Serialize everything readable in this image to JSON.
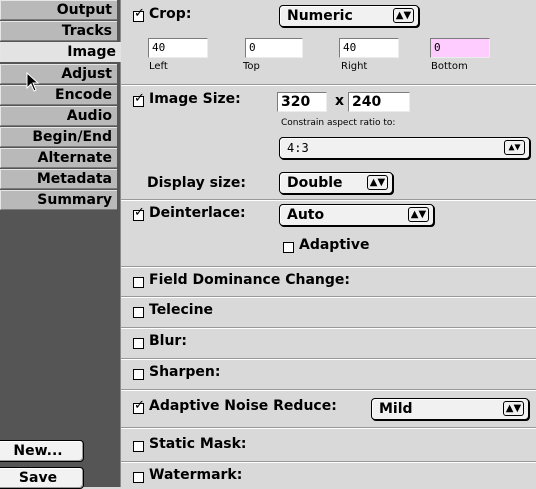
{
  "sidebar": {
    "tabs": [
      {
        "label": "Output"
      },
      {
        "label": "Tracks"
      },
      {
        "label": "Image"
      },
      {
        "label": "Adjust"
      },
      {
        "label": "Encode"
      },
      {
        "label": "Audio"
      },
      {
        "label": "Begin/End"
      },
      {
        "label": "Alternate"
      },
      {
        "label": "Metadata"
      },
      {
        "label": "Summary"
      }
    ],
    "active_tab": "Image",
    "buttons": {
      "new_label": "New...",
      "save_label": "Save"
    }
  },
  "crop": {
    "label": "Crop:",
    "checked": true,
    "mode": "Numeric",
    "left": {
      "value": "40",
      "caption": "Left"
    },
    "top": {
      "value": "0",
      "caption": "Top"
    },
    "right": {
      "value": "40",
      "caption": "Right"
    },
    "bottom": {
      "value": "0",
      "caption": "Bottom"
    }
  },
  "image_size": {
    "label": "Image Size:",
    "checked": true,
    "width": "320",
    "times": "x",
    "height": "240",
    "constrain_label": "Constrain aspect ratio to:",
    "aspect": "4:3",
    "display_size_label": "Display size:",
    "display_size": "Double"
  },
  "deinterlace": {
    "label": "Deinterlace:",
    "checked": true,
    "mode": "Auto",
    "adaptive_label": "Adaptive",
    "adaptive_checked": false
  },
  "options": {
    "field_dominance": {
      "label": "Field Dominance Change:",
      "checked": false
    },
    "telecine": {
      "label": "Telecine",
      "checked": false
    },
    "blur": {
      "label": "Blur:",
      "checked": false
    },
    "sharpen": {
      "label": "Sharpen:",
      "checked": false
    },
    "noise_reduce": {
      "label": "Adaptive Noise Reduce:",
      "checked": true,
      "level": "Mild"
    },
    "static_mask": {
      "label": "Static Mask:",
      "checked": false
    },
    "watermark": {
      "label": "Watermark:",
      "checked": false
    }
  },
  "icons": {
    "popup_arrow": "up-down-arrows",
    "cursor": "arrow-pointer"
  },
  "colors": {
    "sidebar_bg": "#555555",
    "panel_bg": "#d9d9d9",
    "highlight_field": "#ffccff"
  }
}
